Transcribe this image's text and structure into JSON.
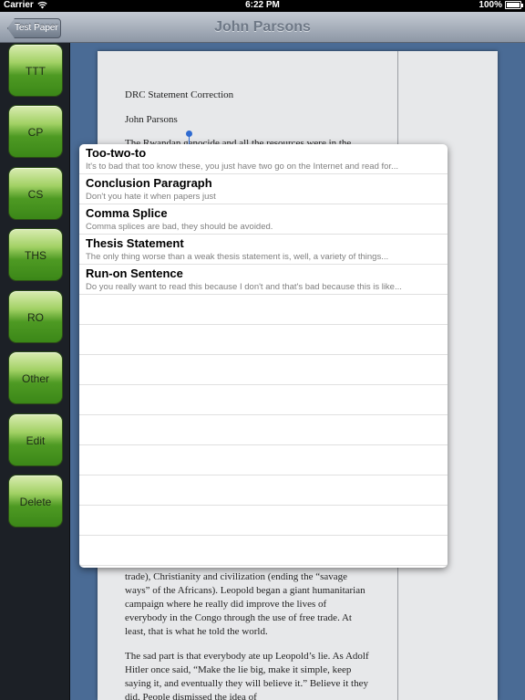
{
  "status_bar": {
    "carrier": "Carrier",
    "time": "6:22 PM",
    "battery": "100%"
  },
  "nav_bar": {
    "back_label": "Test Paper",
    "title": "John Parsons"
  },
  "sidebar": {
    "buttons": [
      "TTT",
      "CP",
      "CS",
      "THS",
      "RO",
      "Other",
      "Edit",
      "Delete"
    ]
  },
  "document": {
    "heading": "DRC Statement Correction",
    "author": "John Parsons",
    "partial_line": "The Rwandan genocide and all the resources were in the",
    "paragraph1": "trade), Christianity and civilization (ending the “savage ways” of the Africans). Leopold began a giant humanitarian campaign where he really did improve the lives of everybody in the Congo through the use of free trade. At least, that is what he told the world.",
    "paragraph2": "The sad part is that everybody ate up Leopold’s lie. As Adolf Hitler once said, “Make the lie big, make it simple, keep saying it, and eventually they will believe it.” Believe it they did. People dismissed the idea of"
  },
  "comments": [
    {
      "title": "Too-two-to",
      "preview": "It's to bad that too know these, you just have two go on the Internet and read for..."
    },
    {
      "title": "Conclusion Paragraph",
      "preview": "Don't you hate it when papers just"
    },
    {
      "title": "Comma Splice",
      "preview": "Comma splices are bad, they should be avoided."
    },
    {
      "title": "Thesis Statement",
      "preview": "The only thing worse than a weak thesis statement is, well, a variety of things..."
    },
    {
      "title": "Run-on Sentence",
      "preview": "Do you really want to read this because I don't and that's bad because this is like..."
    }
  ]
}
